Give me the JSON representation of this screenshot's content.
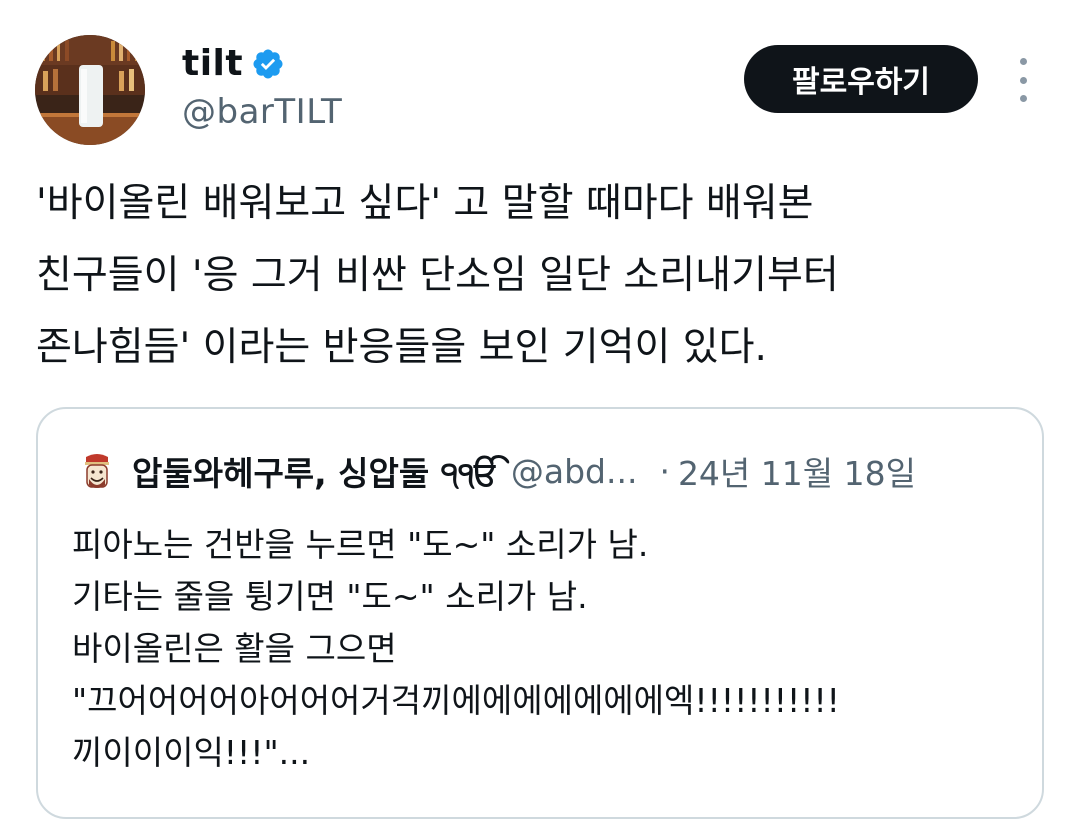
{
  "author": {
    "display_name": "tilt",
    "handle": "@barTILT",
    "verified": true,
    "avatar_icon": "bar-counter-photo-avatar"
  },
  "actions": {
    "follow_label": "팔로우하기",
    "more_icon": "more-vertical-icon"
  },
  "tweet": {
    "lines": [
      "'바이올린 배워보고 싶다' 고 말할 때마다 배워본",
      "친구들이 '응 그거 비싼 단소임 일단 소리내기부터",
      "존나힘듬' 이라는 반응들을 보인 기억이 있다."
    ]
  },
  "quoted_tweet": {
    "display_name": "압둘와헤구루, 싱압둘 ੧ੴ",
    "handle": "@abd...",
    "separator": "·",
    "date": "24년 11월 18일",
    "avatar_icon": "sikh-badge-avatar",
    "lines": [
      "피아노는 건반을 누르면 \"도~\" 소리가 남.",
      "기타는 줄을 튕기면 \"도~\" 소리가 남.",
      "바이올린은 활을 그으면",
      "\"끄어어어어아어어어거걱끼에에에에에에에엑!!!!!!!!!!!",
      "끼이이이익!!!\"..."
    ]
  },
  "colors": {
    "text_primary": "#0f1419",
    "text_secondary": "#536471",
    "verified_blue": "#1d9bf0",
    "border": "#cfd9de",
    "follow_bg": "#0f1419"
  }
}
